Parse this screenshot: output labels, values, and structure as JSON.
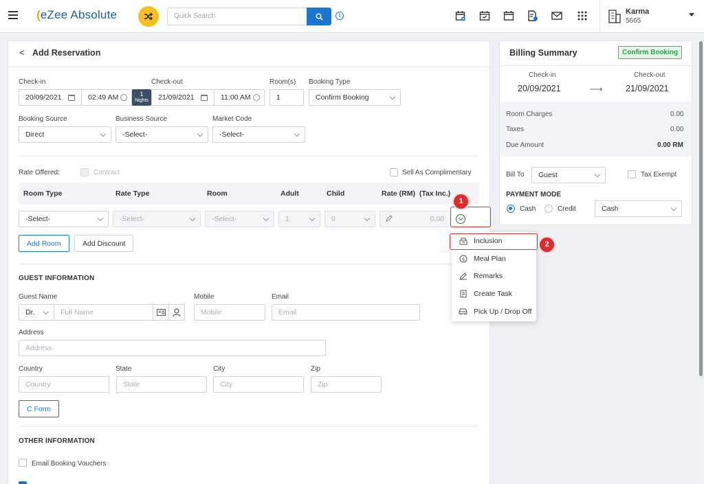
{
  "app": {
    "logo_prefix": "(",
    "logo_text": "eZee Absolute"
  },
  "search": {
    "placeholder": "Quick Search"
  },
  "hotel": {
    "name": "Karma",
    "code": "5665"
  },
  "header": {
    "title": "Add Reservation",
    "back": "<"
  },
  "booking": {
    "checkin_label": "Check-in",
    "checkout_label": "Check-out",
    "rooms_label": "Room(s)",
    "type_label": "Booking Type",
    "checkin_date": "20/09/2021",
    "checkin_time": "02:49 AM",
    "nights_count": "1",
    "nights_label": "Nights",
    "checkout_date": "21/09/2021",
    "checkout_time": "11:00 AM",
    "rooms": "1",
    "type": "Confirm Booking",
    "source_label": "Booking Source",
    "business_label": "Business Source",
    "market_label": "Market Code",
    "source": "Direct",
    "business": "-Select-",
    "market": "-Select-"
  },
  "rates": {
    "offered_label": "Rate Offered:",
    "contract_label": "Contract",
    "complimentary_label": "Sell As Complimentary",
    "columns": [
      "Room Type",
      "Rate Type",
      "Room",
      "Adult",
      "Child",
      "Rate (RM)  (Tax Inc.)"
    ],
    "row": {
      "room_type": "-Select-",
      "rate_type": "-Select-",
      "room": "-Select-",
      "adult": "1",
      "child": "0",
      "rate": "0.00"
    },
    "add_room": "Add Room",
    "add_discount": "Add Discount"
  },
  "guest": {
    "section": "GUEST INFORMATION",
    "name_label": "Guest Name",
    "mobile_label": "Mobile",
    "email_label": "Email",
    "salutation": "Dr.",
    "name_placeholder": "Full Name",
    "mobile_placeholder": "Mobile",
    "email_placeholder": "Email",
    "address_label": "Address",
    "address_placeholder": "Address",
    "country_label": "Country",
    "state_label": "State",
    "city_label": "City",
    "zip_label": "Zip",
    "country_placeholder": "Country",
    "state_placeholder": "State",
    "city_placeholder": "City",
    "zip_placeholder": "Zip",
    "cform": "C Form"
  },
  "other": {
    "section": "OTHER INFORMATION",
    "email_vouchers": "Email Booking Vouchers"
  },
  "menu": {
    "items": [
      "Inclusion",
      "Meal Plan",
      "Remarks",
      "Create Task",
      "Pick Up / Drop Off"
    ]
  },
  "callouts": {
    "one": "1",
    "two": "2"
  },
  "billing": {
    "title": "Billing Summary",
    "status": "Confirm Booking",
    "checkin_label": "Check-in",
    "checkout_label": "Check-out",
    "checkin": "20/09/2021",
    "checkout": "21/09/2021",
    "room_charges_label": "Room Charges",
    "room_charges": "0.00",
    "taxes_label": "Taxes",
    "taxes": "0.00",
    "due_label": "Due Amount",
    "due": "0.00 RM",
    "bill_to_label": "Bill To",
    "bill_to": "Guest",
    "tax_exempt": "Tax Exempt",
    "payment_mode_label": "PAYMENT MODE",
    "cash": "Cash",
    "credit": "Credit",
    "payment_select": "Cash"
  },
  "colors": {
    "accent": "#1976d2",
    "callout": "#e02b2b",
    "confirm_badge": "#2e9e4f"
  }
}
